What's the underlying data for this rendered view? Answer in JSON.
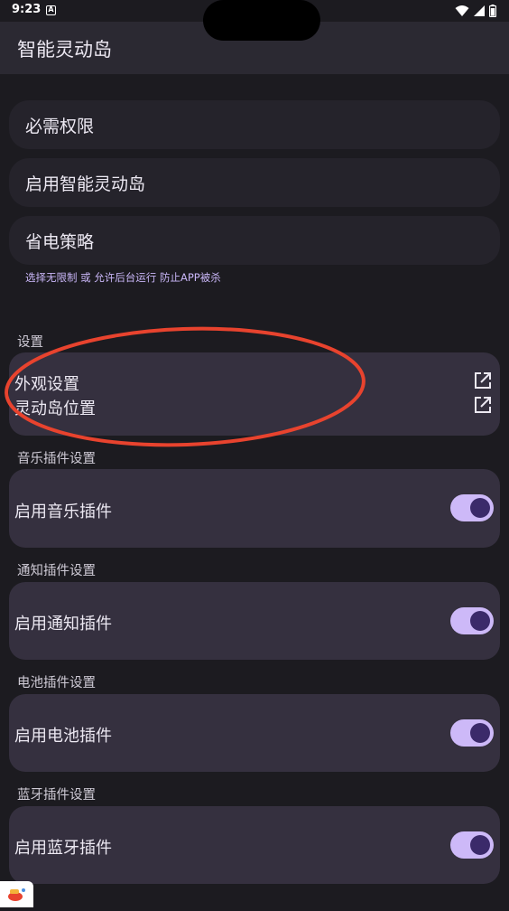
{
  "status_bar": {
    "time": "9:23",
    "notification_icon": "a-badge-icon"
  },
  "app_bar": {
    "title": "智能灵动岛"
  },
  "top_items": [
    {
      "label": "必需权限"
    },
    {
      "label": "启用智能灵动岛"
    },
    {
      "label": "省电策略"
    }
  ],
  "battery_hint": "选择无限制 或 允许后台运行 防止APP被杀",
  "settings_section": {
    "title": "设置",
    "items": [
      {
        "label": "外观设置",
        "icon": "open-external-icon"
      },
      {
        "label": "灵动岛位置",
        "icon": "open-external-icon"
      }
    ]
  },
  "plugin_sections": [
    {
      "title": "音乐插件设置",
      "toggle_label": "启用音乐插件",
      "enabled": true
    },
    {
      "title": "通知插件设置",
      "toggle_label": "启用通知插件",
      "enabled": true
    },
    {
      "title": "电池插件设置",
      "toggle_label": "启用电池插件",
      "enabled": true
    },
    {
      "title": "蓝牙插件设置",
      "toggle_label": "启用蓝牙插件",
      "enabled": true
    }
  ],
  "colors": {
    "background": "#1c1b20",
    "card": "#35303f",
    "accent": "#cdb9f8",
    "knob": "#3b2a6a",
    "annotation": "#e8432e"
  }
}
